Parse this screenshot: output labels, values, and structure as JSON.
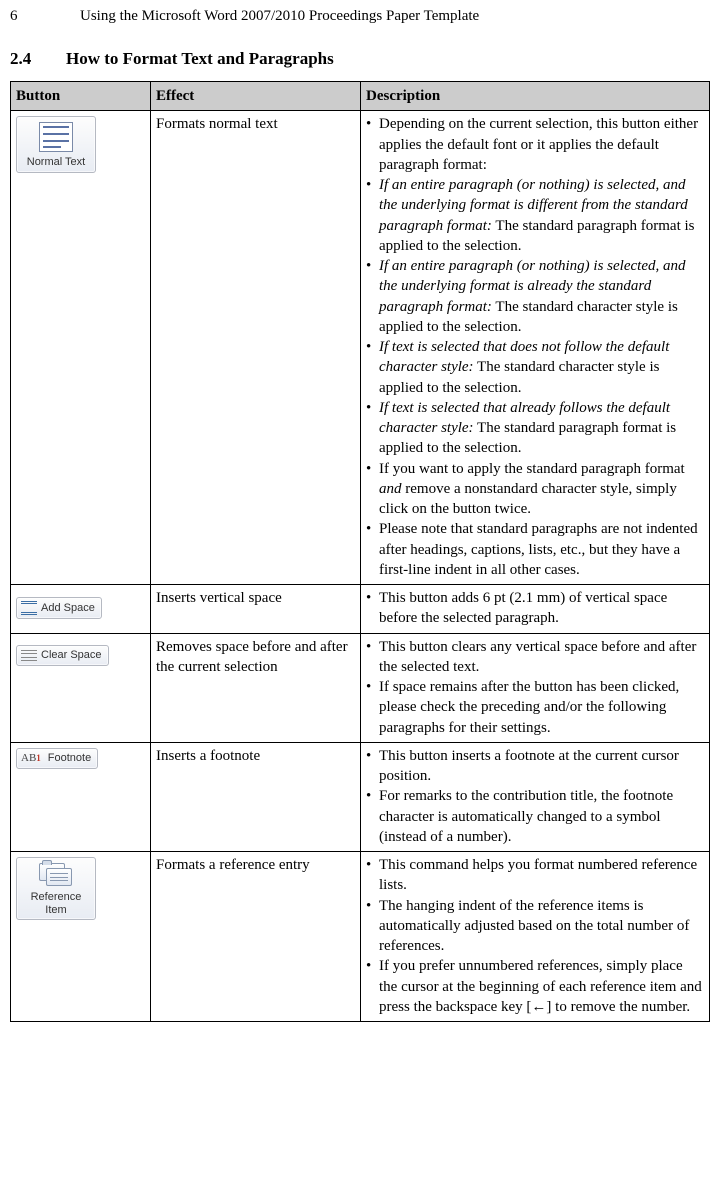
{
  "page": {
    "number": "6",
    "running_title": "Using the Microsoft Word 2007/2010 Proceedings Paper Template"
  },
  "section": {
    "number": "2.4",
    "title": "How to Format Text and Paragraphs"
  },
  "table": {
    "headers": {
      "button": "Button",
      "effect": "Effect",
      "description": "Description"
    },
    "rows": [
      {
        "button_label": "Normal Text",
        "effect": "Formats normal text",
        "desc": [
          {
            "text": "Depending on the current selection, this but­ton either applies the default font or it applies the default paragraph format:"
          },
          {
            "italic_lead": "If an entire paragraph (or nothing) is selected, and the underlying format is different from the standard paragraph format:",
            "rest": " The standard paragraph format is applied to the selection."
          },
          {
            "italic_lead": "If an entire paragraph (or nothing) is selected, and the underlying format is already the stan­dard paragraph format:",
            "rest": " The standard charac­ter style is applied to the selection."
          },
          {
            "italic_lead": "If text is selected that does not follow the default character style:",
            "rest": " The standard charac­ter style is applied to the selection."
          },
          {
            "italic_lead": "If text is selected that already follows the default character style:",
            "rest": " The standard para­graph format is applied to the selection."
          },
          {
            "text_pre": "If you want to apply the standard paragraph format ",
            "italic_mid": "and",
            "text_post": " remove a nonstandard character style, simply click on the button twice."
          },
          {
            "text": "Please note that standard paragraphs are not indented after headings, captions, lists, etc., but they have a first-line indent in all other cases."
          }
        ]
      },
      {
        "button_label": "Add Space",
        "effect": "Inserts vertical space",
        "desc": [
          {
            "text": "This button adds 6 pt (2.1 mm) of vertical space before the selected paragraph."
          }
        ]
      },
      {
        "button_label": "Clear Space",
        "effect": "Removes space before and after the current selection",
        "desc": [
          {
            "text": "This button clears any vertical space before and after the selected text."
          },
          {
            "text": "If space remains after the button has been clicked, please check the preceding and/or the following paragraphs for their settings."
          }
        ]
      },
      {
        "button_label": "Footnote",
        "effect": "Inserts a footnote",
        "desc": [
          {
            "text": "This button inserts a footnote at the current cursor position."
          },
          {
            "text": "For remarks to the contribution title, the footnote character is automatically changed to a symbol (instead of a number)."
          }
        ]
      },
      {
        "button_label": "Reference Item",
        "effect": "Formats a reference entry",
        "desc": [
          {
            "text": "This command helps you format numbered reference lists."
          },
          {
            "text": "The hanging indent of the reference items is automatically adjusted based on the total number of references."
          },
          {
            "text": "If you prefer unnumbered references, simply place the cursor at the beginning of each ref­erence item and press the backspace key [←] to remove the number."
          }
        ]
      }
    ]
  }
}
